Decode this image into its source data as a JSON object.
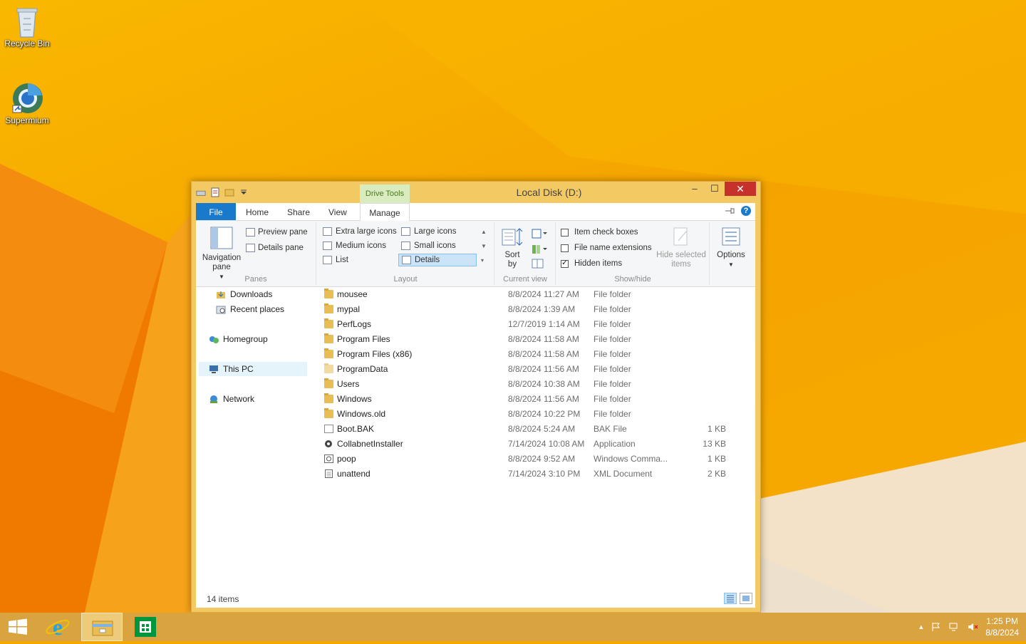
{
  "desktop": {
    "icons": [
      {
        "label": "Recycle Bin",
        "icon": "recycle-bin-icon"
      },
      {
        "label": "Supermium",
        "icon": "browser-icon"
      }
    ]
  },
  "window": {
    "title": "Local Disk (D:)",
    "context_tab": "Drive Tools",
    "buttons": {
      "minimize": "–",
      "maximize": "☐",
      "close": "✕"
    }
  },
  "tabs": {
    "file": "File",
    "home": "Home",
    "share": "Share",
    "view": "View",
    "manage": "Manage",
    "help": "?"
  },
  "ribbon": {
    "panes": {
      "navigation_pane": "Navigation pane",
      "preview_pane": "Preview pane",
      "details_pane": "Details pane",
      "label": "Panes"
    },
    "layout": {
      "options": [
        "Extra large icons",
        "Large icons",
        "Medium icons",
        "Small icons",
        "List",
        "Details"
      ],
      "selected": "Details",
      "label": "Layout"
    },
    "current_view": {
      "sort_by": "Sort by",
      "label": "Current view"
    },
    "show_hide": {
      "item_check_boxes": {
        "label": "Item check boxes",
        "checked": false
      },
      "file_name_extensions": {
        "label": "File name extensions",
        "checked": false
      },
      "hidden_items": {
        "label": "Hidden items",
        "checked": true
      },
      "hide_selected": "Hide selected items",
      "label": "Show/hide"
    },
    "options": "Options"
  },
  "nav_pane": {
    "items": [
      {
        "label": "Downloads",
        "icon": "downloads-icon"
      },
      {
        "label": "Recent places",
        "icon": "recent-places-icon"
      },
      {
        "label": "Homegroup",
        "icon": "homegroup-icon"
      },
      {
        "label": "This PC",
        "icon": "this-pc-icon",
        "selected": true
      },
      {
        "label": "Network",
        "icon": "network-icon"
      }
    ]
  },
  "files": [
    {
      "name": "mousee",
      "date": "8/8/2024 11:27 AM",
      "type": "File folder",
      "size": ""
    },
    {
      "name": "mypal",
      "date": "8/8/2024 1:39 AM",
      "type": "File folder",
      "size": ""
    },
    {
      "name": "PerfLogs",
      "date": "12/7/2019 1:14 AM",
      "type": "File folder",
      "size": ""
    },
    {
      "name": "Program Files",
      "date": "8/8/2024 11:58 AM",
      "type": "File folder",
      "size": ""
    },
    {
      "name": "Program Files (x86)",
      "date": "8/8/2024 11:58 AM",
      "type": "File folder",
      "size": ""
    },
    {
      "name": "ProgramData",
      "date": "8/8/2024 11:56 AM",
      "type": "File folder",
      "size": ""
    },
    {
      "name": "Users",
      "date": "8/8/2024 10:38 AM",
      "type": "File folder",
      "size": ""
    },
    {
      "name": "Windows",
      "date": "8/8/2024 11:56 AM",
      "type": "File folder",
      "size": ""
    },
    {
      "name": "Windows.old",
      "date": "8/8/2024 10:22 PM",
      "type": "File folder",
      "size": ""
    },
    {
      "name": "Boot.BAK",
      "date": "8/8/2024 5:24 AM",
      "type": "BAK File",
      "size": "1 KB"
    },
    {
      "name": "CollabnetInstaller",
      "date": "7/14/2024 10:08 AM",
      "type": "Application",
      "size": "13 KB"
    },
    {
      "name": "poop",
      "date": "8/8/2024 9:52 AM",
      "type": "Windows Comma...",
      "size": "1 KB"
    },
    {
      "name": "unattend",
      "date": "7/14/2024 3:10 PM",
      "type": "XML Document",
      "size": "2 KB"
    }
  ],
  "status": {
    "count": "14 items"
  },
  "taskbar": {
    "time": "1:25 PM",
    "date": "8/8/2024",
    "apps": [
      "start-icon",
      "internet-explorer-icon",
      "file-explorer-icon",
      "store-icon"
    ]
  }
}
